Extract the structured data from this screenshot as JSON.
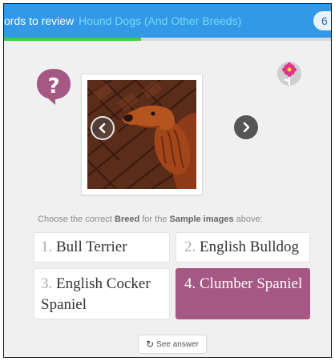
{
  "header": {
    "title": "ords to review",
    "subtitle_link": "Hound Dogs (And Other Breeds)",
    "badge": "6",
    "progress": 0.42
  },
  "icons": {
    "help": "question-mark-speech-bubble",
    "flower": "pink-flower",
    "prev": "chevron-left",
    "next": "chevron-right"
  },
  "prompt": {
    "lead": "Choose the correct",
    "keyword1": "Breed",
    "middle": "for the",
    "keyword2": "Sample images",
    "tail": "above:"
  },
  "options": [
    {
      "num": "1.",
      "label": "Bull Terrier"
    },
    {
      "num": "2.",
      "label": "English Bulldog"
    },
    {
      "num": "3.",
      "label": "English Cocker Spaniel"
    },
    {
      "num": "4.",
      "label": "Clumber Spaniel",
      "selected": true
    }
  ],
  "see_answer": {
    "label": "See answer"
  },
  "colors": {
    "header_bg": "#3399e6",
    "progress": "#44cc44",
    "accent": "#a65884"
  }
}
